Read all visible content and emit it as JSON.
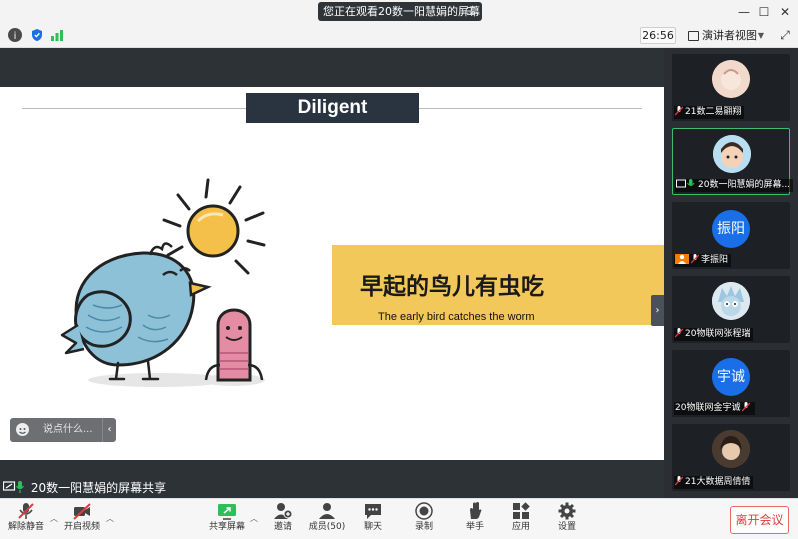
{
  "window": {
    "sharing_banner": "您正在观看20数一阳慧娟的屏幕",
    "timer": "26:56",
    "view_mode": "演讲者视图"
  },
  "slide": {
    "title": "Diligent",
    "headline": "早起的鸟儿有虫吃",
    "subtitle": "The early bird catches the worm"
  },
  "comment": {
    "placeholder": "说点什么..."
  },
  "share_label": "20数一阳慧娟的屏幕共享",
  "participants": [
    {
      "name": "21数二易翮翔",
      "avatar_text": ""
    },
    {
      "name": "20数一阳慧娟的屏幕...",
      "avatar_text": ""
    },
    {
      "name": "李振阳",
      "avatar_text": "振阳"
    },
    {
      "name": "20物联网张程瑞",
      "avatar_text": ""
    },
    {
      "name": "20物联网金宇诚",
      "avatar_text": "宇诚"
    },
    {
      "name": "21大数据周倩倩",
      "avatar_text": ""
    }
  ],
  "bottom": {
    "unmute": "解除静音",
    "start_video": "开启视频",
    "share_screen": "共享屏幕",
    "invite": "邀请",
    "members": "成员(50)",
    "chat": "聊天",
    "record": "录制",
    "raise_hand": "举手",
    "apps": "应用",
    "settings": "设置",
    "leave": "离开会议"
  },
  "colors": {
    "accent_yellow": "#f3c85a",
    "title_navy": "#2a3340",
    "leave_red": "#e23a3a",
    "active_green": "#3bbf6f",
    "avatar_blue": "#1a6fe8"
  }
}
